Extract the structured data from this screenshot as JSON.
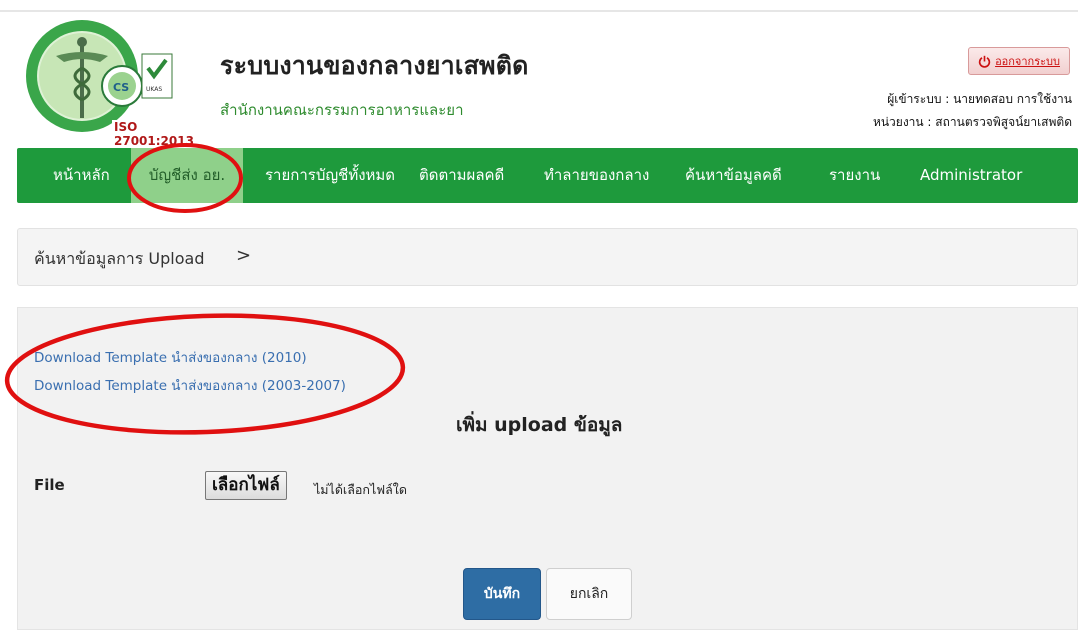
{
  "header": {
    "title": "ระบบงานของกลางยาเสพติด",
    "subtitle": "สำนักงานคณะกรรมการอาหารและยา",
    "iso_badge": "ISO 27001:2013",
    "logout_label": "ออกจากระบบ",
    "user_line": "ผู้เข้าระบบ : นายทดสอบ การใช้งาน",
    "unit_line": "หน่วยงาน : สถานตรวจพิสูจน์ยาเสพติด"
  },
  "nav": {
    "items": [
      {
        "label": "หน้าหลัก"
      },
      {
        "label": "บัญชีส่ง อย."
      },
      {
        "label": "รายการบัญชีทั้งหมด"
      },
      {
        "label": "ติดตามผลคดี"
      },
      {
        "label": "ทำลายของกลาง"
      },
      {
        "label": "ค้นหาข้อมูลคดี"
      },
      {
        "label": "รายงาน"
      },
      {
        "label": "Administrator"
      }
    ],
    "active_index": 1
  },
  "breadcrumb": {
    "text": "ค้นหาข้อมูลการ Upload",
    "separator": ">"
  },
  "main": {
    "links": [
      {
        "label": "Download Template นำส่งของกลาง (2010)"
      },
      {
        "label": "Download Template นำส่งของกลาง (2003-2007)"
      }
    ],
    "title": "เพิ่ม upload ข้อมูล",
    "file_label": "File",
    "file_button": "เลือกไฟล์",
    "file_status": "ไม่ได้เลือกไฟล์ใด",
    "save_label": "บันทึก",
    "cancel_label": "ยกเลิก"
  },
  "colors": {
    "nav_green": "#1e9a3c",
    "nav_active": "#8fd08a",
    "link_blue": "#3a6fb0",
    "primary_button": "#2e6da4",
    "annotation_red": "#e01010"
  },
  "icons": {
    "logout": "power-icon",
    "breadcrumb": "chevron-right-icon"
  }
}
